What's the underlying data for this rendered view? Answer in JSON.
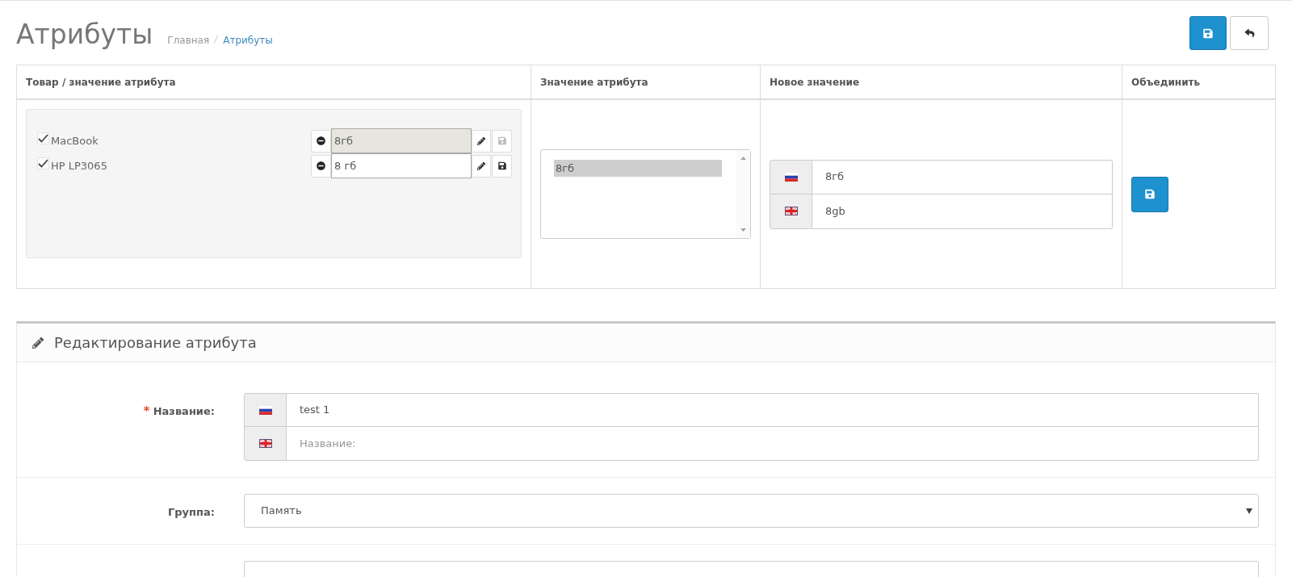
{
  "page": {
    "title": "Атрибуты",
    "breadcrumb": [
      {
        "label": "Главная",
        "selected": false
      },
      {
        "label": "Атрибуты",
        "selected": true
      }
    ]
  },
  "toolbar": [
    {
      "kind": "save"
    },
    {
      "kind": "back"
    }
  ],
  "table": {
    "columns": [
      "Товар / значение атрибута",
      "Значение атрибута",
      "Новое значение",
      "Объединить"
    ],
    "products": [
      {
        "name": "MacBook",
        "checked": true,
        "value": "8гб",
        "disabled": true
      },
      {
        "name": "HP LP3065",
        "checked": true,
        "value": "8 гб",
        "disabled": false
      }
    ],
    "values_list": [
      {
        "label": "8гб",
        "selected": true
      }
    ],
    "new_value": [
      {
        "kind": "russian",
        "value": "8гб"
      },
      {
        "kind": "english",
        "value": "8gb"
      }
    ]
  },
  "edit_panel": {
    "title": "Редактирование атрибута",
    "fields": [
      {
        "kind": "multilang",
        "label": "Название:",
        "required": true,
        "inputs": [
          {
            "kind": "russian",
            "value": "test 1"
          },
          {
            "kind": "english",
            "placeholder": "Название:"
          }
        ]
      },
      {
        "kind": "select",
        "label": "Группа:",
        "required": false,
        "value": "Память"
      },
      {
        "kind": "text"
      }
    ]
  }
}
